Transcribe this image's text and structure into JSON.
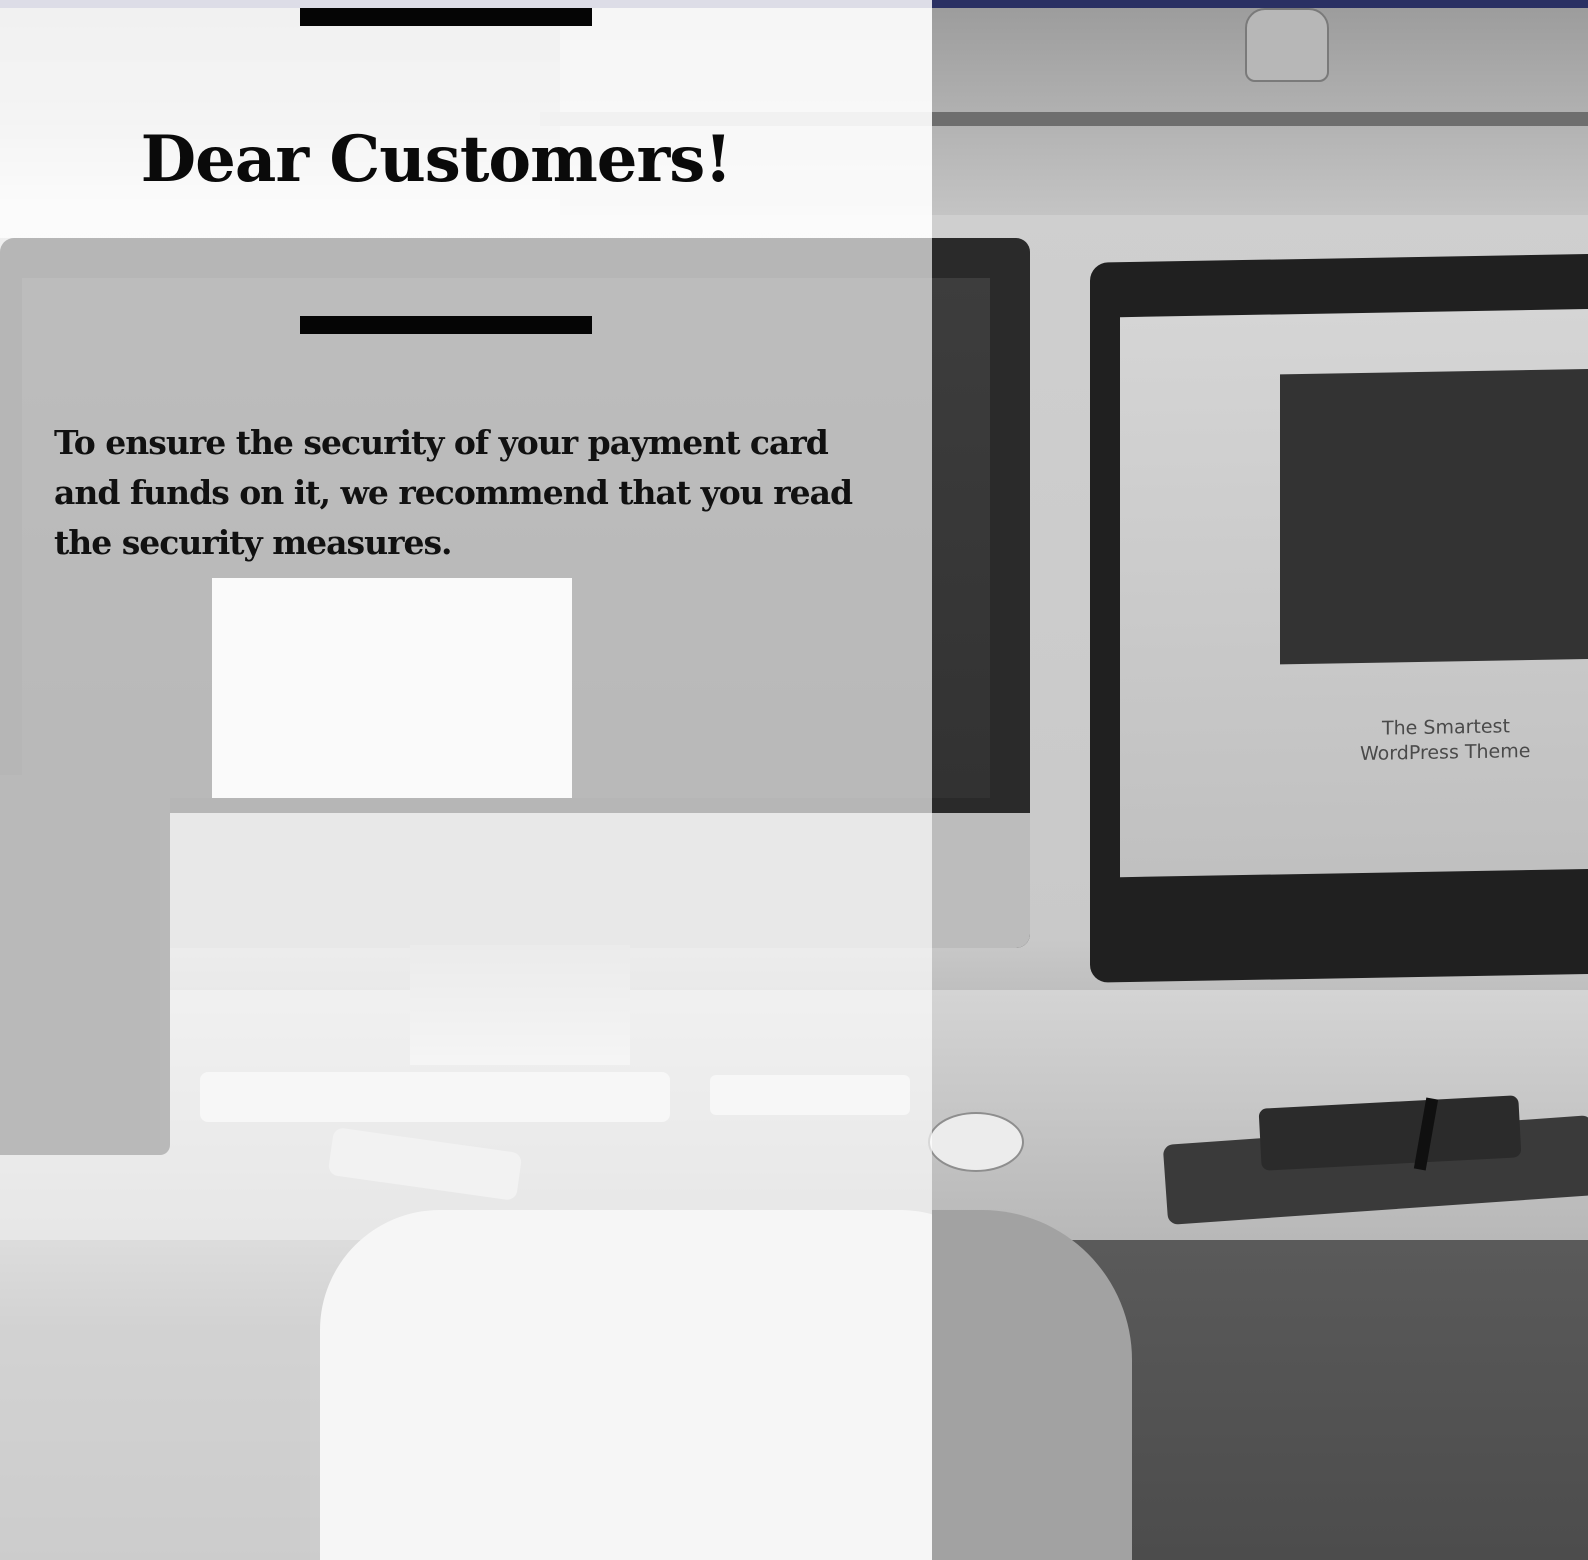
{
  "heading": "Dear Customers!",
  "message": "To ensure the security of your payment card and funds on it, we recommend that you read the security measures.",
  "background_photo": {
    "screen_text_line1": "The Smartest",
    "screen_text_line2": "WordPress Theme"
  },
  "colors": {
    "top_bar_left": "#dddde7",
    "top_bar_right": "#2a3063",
    "rule": "#050505",
    "text": "#0a0a0a"
  }
}
